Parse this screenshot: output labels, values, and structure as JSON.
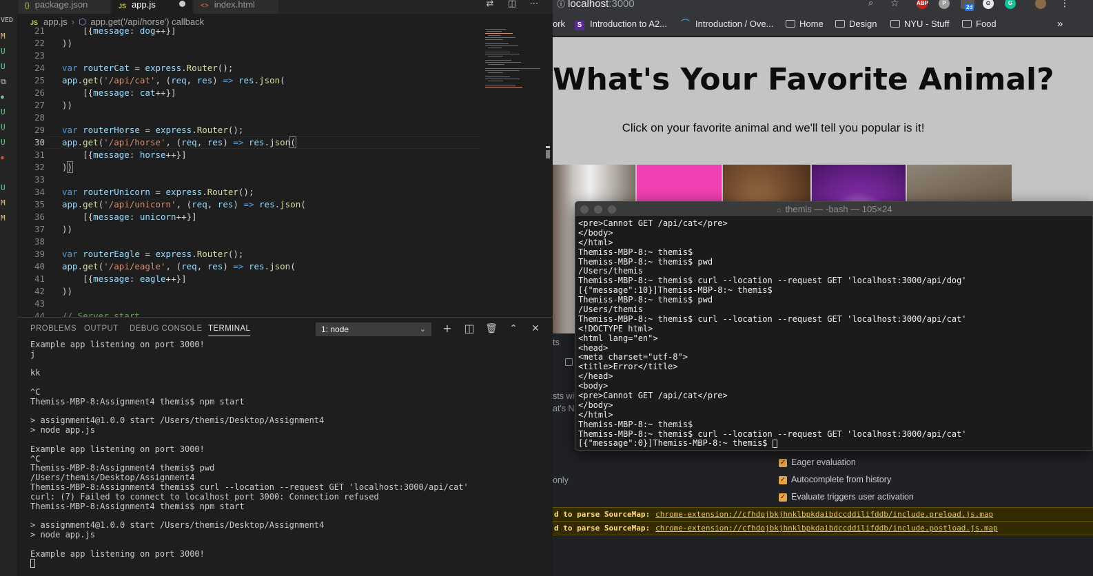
{
  "vscode": {
    "tabs": [
      {
        "icon": "{}",
        "label": "package.json",
        "icon_color": "#cbcb41"
      },
      {
        "icon": "JS",
        "label": "app.js",
        "icon_color": "#cbcb41"
      },
      {
        "icon": "<>",
        "label": "index.html",
        "icon_color": "#e37933"
      }
    ],
    "breadcrumb": {
      "file_icon": "JS",
      "file": "app.js",
      "symbol": "app.get('/api/horse') callback"
    },
    "activity_labels": [
      "VED",
      "M",
      "U",
      "U",
      "U",
      "U",
      "U",
      "U",
      "M",
      "M"
    ],
    "panel_tabs": [
      "PROBLEMS",
      "OUTPUT",
      "DEBUG CONSOLE",
      "TERMINAL"
    ],
    "terminal_select": "1: node",
    "terminal_output": [
      "Example app listening on port 3000!",
      "j",
      "",
      "kk",
      "",
      "^C",
      "Themiss-MBP-8:Assignment4 themis$ npm start",
      "",
      "> assignment4@1.0.0 start /Users/themis/Desktop/Assignment4",
      "> node app.js",
      "",
      "Example app listening on port 3000!",
      "^C",
      "Themiss-MBP-8:Assignment4 themis$ pwd",
      "/Users/themis/Desktop/Assignment4",
      "Themiss-MBP-8:Assignment4 themis$ curl --location --request GET 'localhost:3000/api/cat'",
      "curl: (7) Failed to connect to localhost port 3000: Connection refused",
      "Themiss-MBP-8:Assignment4 themis$ npm start",
      "",
      "> assignment4@1.0.0 start /Users/themis/Desktop/Assignment4",
      "> node app.js",
      "",
      "Example app listening on port 3000!"
    ]
  },
  "code_line_numbers": [
    "21",
    "22",
    "23",
    "24",
    "25",
    "26",
    "27",
    "28",
    "29",
    "30",
    "31",
    "32",
    "33",
    "34",
    "35",
    "36",
    "37",
    "38",
    "39",
    "40",
    "41",
    "42",
    "43",
    "44"
  ],
  "browser": {
    "url_host": "localhost",
    "url_port": ":3000",
    "bookmarks": [
      "ork",
      "Introduction to A2...",
      "Introduction / Ove...",
      "Home",
      "Design",
      "NYU - Stuff",
      "Food"
    ],
    "extensions": [
      "ABP",
      "2d"
    ],
    "page_title": "What's Your Favorite Animal?",
    "page_subtitle": "Click on your favorite animal and we'll tell you popular is it!",
    "devtools": {
      "settings": [
        "Eager evaluation",
        "Autocomplete from history",
        "Evaluate triggers user activation"
      ],
      "partial_left": [
        "ts",
        "sts wit",
        "at's N",
        "only"
      ],
      "warnings": [
        {
          "prefix": "d to parse SourceMap:",
          "link": "chrome-extension://cfhdojbkjhnklbpkdaibdccddilifddb/include.preload.js.map"
        },
        {
          "prefix": "d to parse SourceMap:",
          "link": "chrome-extension://cfhdojbkjhnklbpkdaibdccddilifddb/include.postload.js.map"
        }
      ]
    }
  },
  "mac_terminal": {
    "title": "themis — -bash — 105×24",
    "lines": [
      "<pre>Cannot GET /api/cat</pre>",
      "</body>",
      "</html>",
      "Themiss-MBP-8:~ themis$",
      "Themiss-MBP-8:~ themis$ pwd",
      "/Users/themis",
      "Themiss-MBP-8:~ themis$ curl --location --request GET 'localhost:3000/api/dog'",
      "[{\"message\":10}]Themiss-MBP-8:~ themis$",
      "Themiss-MBP-8:~ themis$ pwd",
      "/Users/themis",
      "Themiss-MBP-8:~ themis$ curl --location --request GET 'localhost:3000/api/cat'",
      "<!DOCTYPE html>",
      "<html lang=\"en\">",
      "<head>",
      "<meta charset=\"utf-8\">",
      "<title>Error</title>",
      "</head>",
      "<body>",
      "<pre>Cannot GET /api/cat</pre>",
      "</body>",
      "</html>",
      "Themiss-MBP-8:~ themis$",
      "Themiss-MBP-8:~ themis$ curl --location --request GET 'localhost:3000/api/cat'",
      "[{\"message\":0}]Themiss-MBP-8:~ themis$ "
    ]
  }
}
